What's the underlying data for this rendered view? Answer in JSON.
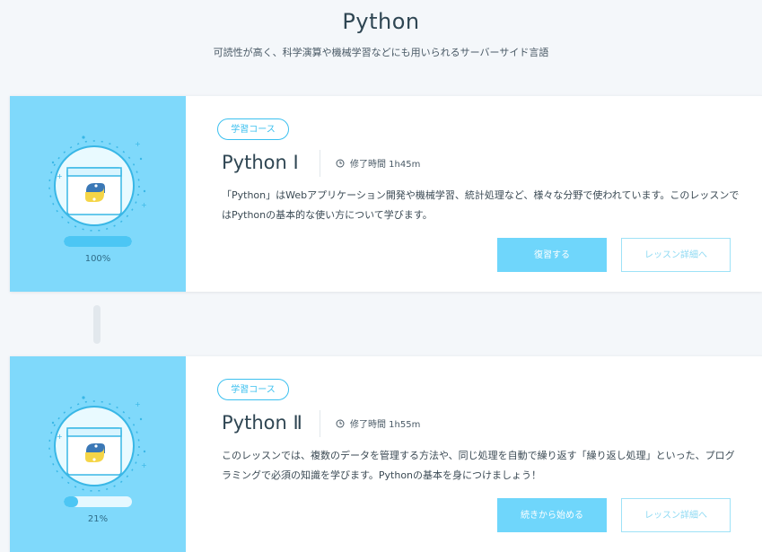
{
  "header": {
    "title": "Python",
    "subtitle": "可読性が高く、科学演算や機械学習などにも用いられるサーバーサイド言語"
  },
  "courses": [
    {
      "badge": "学習コース",
      "title": "Python Ⅰ",
      "duration": "修了時間 1h45m",
      "description": "「Python」はWebアプリケーション開発や機械学習、統計処理など、様々な分野で使われています。このレッスンではPythonの基本的な使い方について学びます。",
      "progress_text": "100%",
      "progress": 1.0,
      "primary_button": "復習する",
      "secondary_button": "レッスン詳細へ"
    },
    {
      "badge": "学習コース",
      "title": "Python Ⅱ",
      "duration": "修了時間 1h55m",
      "description": "このレッスンでは、複数のデータを管理する方法や、同じ処理を自動で繰り返す「繰り返し処理」といった、プログラミングで必須の知識を学びます。Pythonの基本を身につけましょう！",
      "progress_text": "21%",
      "progress": 0.21,
      "primary_button": "続きから始める",
      "secondary_button": "レッスン詳細へ"
    }
  ],
  "colors": {
    "accent": "#4cc6f4",
    "card_side": "#7fd9fb",
    "button_primary": "#6fd6fb",
    "text_dark": "#2f4653"
  },
  "icons": {
    "course_illustration": "python-logo-illustration",
    "clock": "clock-icon"
  }
}
